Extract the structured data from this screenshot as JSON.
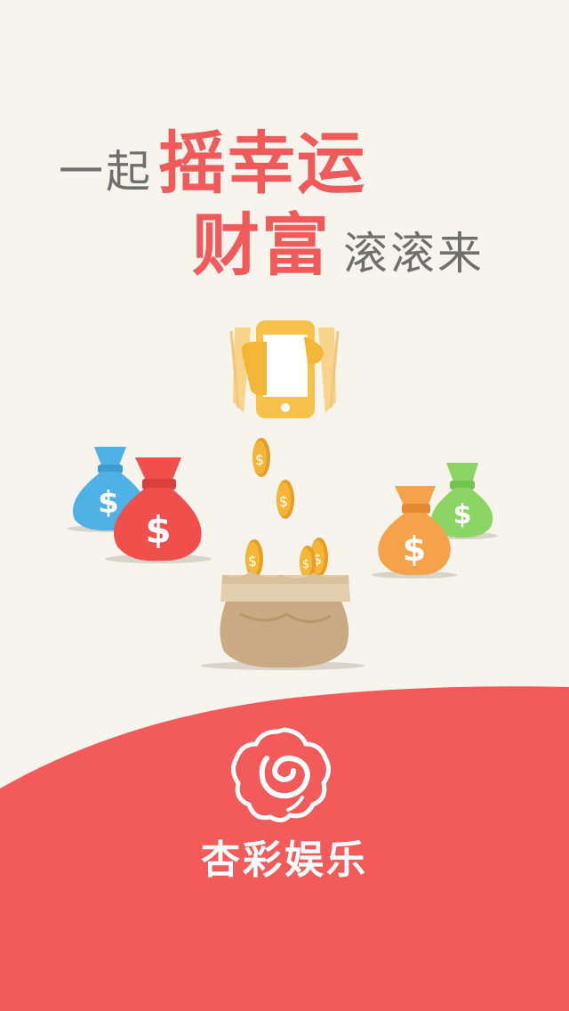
{
  "slogan": {
    "line1_soft": "一起",
    "line1_bold": "摇幸运",
    "line2_bold": "财富",
    "line2_soft": "滚滚来"
  },
  "brand": {
    "name": "杏彩娱乐"
  },
  "colors": {
    "background": "#f6f4ec",
    "accent_red": "#f05a5a",
    "footer_red": "#f25b5a",
    "phone_yellow": "#f7c24a",
    "coin_gold": "#f4b637",
    "bag_blue": "#4fb1e5",
    "bag_red": "#f04f4b",
    "bag_orange": "#f6a24a",
    "bag_green": "#8cd464",
    "sack_brown": "#c9aa82"
  },
  "icons": [
    "phone-shake-icon",
    "coin-icon",
    "money-bag-icon",
    "sack-icon",
    "brand-logo-icon"
  ]
}
